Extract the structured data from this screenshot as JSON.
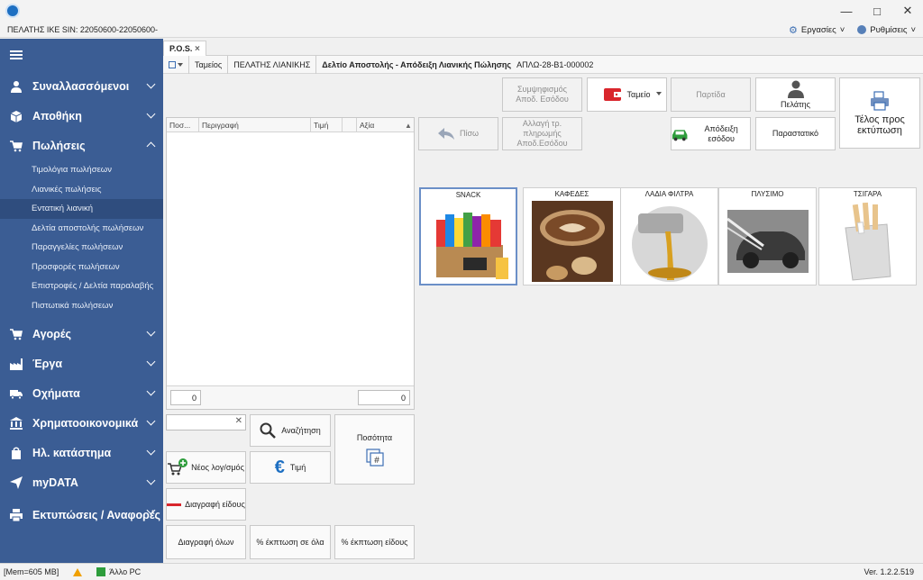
{
  "header": {
    "company": "ΠΕΛΑΤΗΣ ΙΚΕ SIN: 22050600-22050600-",
    "menu_tasks": "Εργασίες",
    "menu_settings": "Ρυθμίσεις"
  },
  "sidebar": {
    "items": [
      {
        "label": "Συναλλασσόμενοι"
      },
      {
        "label": "Αποθήκη"
      },
      {
        "label": "Πωλήσεις"
      },
      {
        "label": "Αγορές"
      },
      {
        "label": "Έργα"
      },
      {
        "label": "Οχήματα"
      },
      {
        "label": "Χρηματοοικονομικά"
      },
      {
        "label": "Ηλ. κατάστημα"
      },
      {
        "label": "myDATA"
      },
      {
        "label": "Εκτυπώσεις / Αναφορές"
      }
    ],
    "sales_sub": [
      {
        "label": "Τιμολόγια πωλήσεων"
      },
      {
        "label": "Λιανικές πωλήσεις"
      },
      {
        "label": "Εντατική λιανική"
      },
      {
        "label": "Δελτία αποστολής πωλήσεων"
      },
      {
        "label": "Παραγγελίες πωλήσεων"
      },
      {
        "label": "Προσφορές πωλήσεων"
      },
      {
        "label": "Επιστροφές / Δελτία παραλαβής"
      },
      {
        "label": "Πιστωτικά πωλήσεων"
      }
    ]
  },
  "tab": {
    "label": "P.O.S.",
    "close": "×"
  },
  "breadcrumb": {
    "register": "Ταμείος",
    "customer": "ΠΕΛΑΤΗΣ ΛΙΑΝΙΚΗΣ",
    "document": "Δελτίο Αποστολής - Απόδειξη Λιανικής Πώλησης",
    "code": "ΑΠΛΩ-28-Β1-000002"
  },
  "grid": {
    "columns": [
      "Ποσ...",
      "Περιγραφή",
      "Τιμή",
      "",
      "Αξία"
    ],
    "qty_total": "0",
    "value_total": "0"
  },
  "buttons": {
    "search": "Αναζήτηση",
    "quantity": "Ποσότητα",
    "new_account": "Νέος λογ/σμός",
    "price": "Τιμή",
    "delete_item": "Διαγραφή είδους",
    "delete_all": "Διαγραφή όλων",
    "discount_all": "% έκπτωση σε όλα",
    "discount_item": "% έκπτωση είδους",
    "reconcile": "Συμψηφισμός Αποδ. Εσόδου",
    "cashier": "Ταμείο",
    "batch": "Παρτίδα",
    "customer": "Πελάτης",
    "finish_print": "Τέλος προς εκτύπωση",
    "back": "Πίσω",
    "change_payment": "Αλλαγή τρ. πληρωμής Αποδ.Εσόδου",
    "receipt": "Απόδειξη εσόδου",
    "document": "Παραστατικό"
  },
  "categories": [
    {
      "label": "SNACK"
    },
    {
      "label": "ΚΑΦΕΔΕΣ"
    },
    {
      "label": "ΛΑΔΙΑ ΦΙΛΤΡΑ"
    },
    {
      "label": "ΠΛΥΣΙΜΟ"
    },
    {
      "label": "ΤΣΙΓΑΡΑ"
    }
  ],
  "status": {
    "mem": "[Mem=605 MB]",
    "pc": "Άλλο PC",
    "version": "Ver. 1.2.2.519"
  },
  "colors": {
    "sidebar": "#3b5d94",
    "sidebar_active": "#2f4d7e",
    "accent": "#3d6fb3"
  }
}
